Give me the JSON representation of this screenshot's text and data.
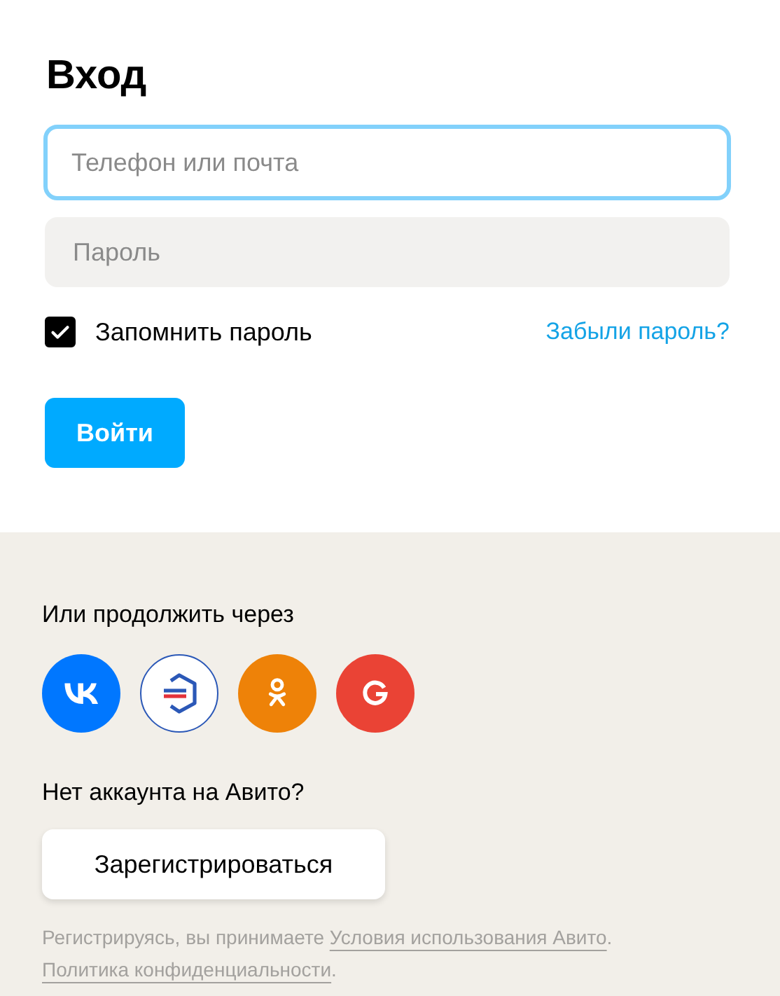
{
  "title": "Вход",
  "login_field": {
    "placeholder": "Телефон или почта",
    "focused": true
  },
  "password_field": {
    "placeholder": "Пароль"
  },
  "remember": {
    "label": "Запомнить пароль",
    "checked": true
  },
  "forgot_link": "Забыли пароль?",
  "submit_button": "Войти",
  "social": {
    "heading": "Или продолжить через",
    "buttons": [
      {
        "kind": "vk",
        "color": "#0077ff"
      },
      {
        "kind": "gosuslugi",
        "color": "#ffffff"
      },
      {
        "kind": "ok",
        "color": "#ee8208"
      },
      {
        "kind": "google",
        "color": "#ea4335"
      }
    ]
  },
  "register": {
    "question": "Нет аккаунта на Авито?",
    "button": "Зарегистрироваться"
  },
  "legal": {
    "text": "Регистрируясь, вы принимаете",
    "terms_link": "Условия использования Авито",
    "separator": ".",
    "privacy_link": "Политика конфиденциальности",
    "end": "."
  }
}
